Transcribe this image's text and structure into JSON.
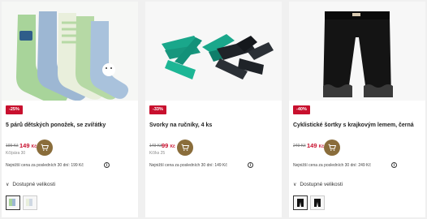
{
  "products": [
    {
      "discount": "-25%",
      "title": "5 párů dětských ponožek, se zvířátky",
      "old_price": "199 Kč",
      "new_price": "149",
      "currency": "Kč",
      "was_label": "Kč/pára 30",
      "lowest_label": "Nejnižší cena za posledních 30 dní: 199 Kč",
      "sizes_label": "Dostupné velikosti"
    },
    {
      "discount": "-33%",
      "title": "Svorky na ručníky, 4 ks",
      "old_price": "149 Kč",
      "new_price": "99",
      "currency": "Kč",
      "was_label": "Kč/ks 25",
      "lowest_label": "Nejnižší cena za posledních 30 dní: 149 Kč",
      "sizes_label": ""
    },
    {
      "discount": "-40%",
      "title": "Cyklistické šortky s krajkovým lemem, černá",
      "old_price": "249 Kč",
      "new_price": "149",
      "currency": "Kč",
      "was_label": "",
      "lowest_label": "Nejnižší cena za posledních 30 dní: 249 Kč",
      "sizes_label": "Dostupné velikosti"
    }
  ],
  "icons": {
    "cart": "cart-icon",
    "info": "info-icon",
    "chevron": "chevron-down-icon"
  },
  "colors": {
    "discount": "#c8102e",
    "cart_button": "#8a6d3b",
    "price": "#c8102e"
  }
}
